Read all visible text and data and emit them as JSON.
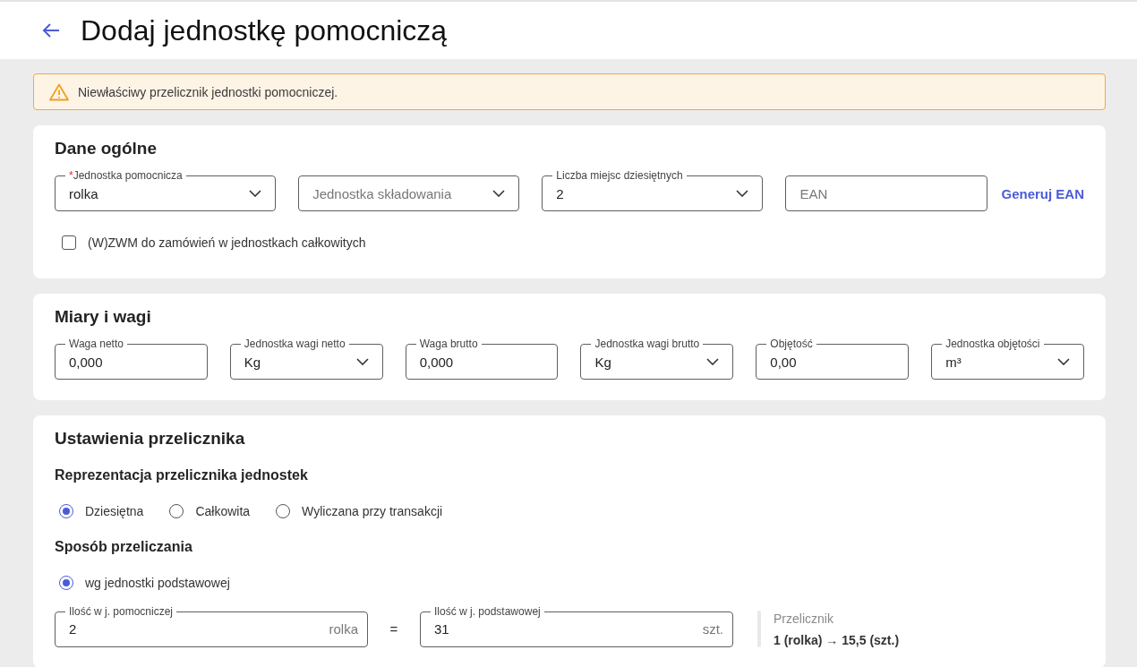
{
  "header": {
    "title": "Dodaj jednostkę pomocniczą"
  },
  "alert": {
    "kind": "warning",
    "message": "Niewłaściwy przelicznik jednostki pomocniczej."
  },
  "general": {
    "title": "Dane ogólne",
    "fields": [
      {
        "kind": "select",
        "required_mark": "*",
        "label": "Jednostka pomocnicza",
        "value": "rolka"
      },
      {
        "kind": "select",
        "placeholder": "Jednostka składowania"
      },
      {
        "kind": "select",
        "label": "Liczba miejsc dziesiętnych",
        "value": "2"
      },
      {
        "kind": "text",
        "placeholder": "EAN"
      }
    ],
    "generate_link": "Generuj EAN",
    "checkbox": {
      "label": "(W)ZWM do zamówień w jednostkach całkowitych",
      "checked": false
    }
  },
  "measures": {
    "title": "Miary i wagi",
    "fields": [
      {
        "kind": "text",
        "label": "Waga netto",
        "value": "0,000"
      },
      {
        "kind": "select",
        "label": "Jednostka wagi netto",
        "value": "Kg"
      },
      {
        "kind": "text",
        "label": "Waga brutto",
        "value": "0,000"
      },
      {
        "kind": "select",
        "label": "Jednostka wagi brutto",
        "value": "Kg"
      },
      {
        "kind": "text",
        "label": "Objętość",
        "value": "0,00"
      },
      {
        "kind": "select",
        "label": "Jednostka objętości",
        "value": "m³"
      }
    ]
  },
  "converter": {
    "title": "Ustawienia przelicznika",
    "representation": {
      "title": "Reprezentacja przelicznika jednostek",
      "options": [
        {
          "label": "Dziesiętna",
          "selected": true
        },
        {
          "label": "Całkowita",
          "selected": false
        },
        {
          "label": "Wyliczana przy transakcji",
          "selected": false
        }
      ]
    },
    "method": {
      "title": "Sposób przeliczania",
      "options": [
        {
          "label": "wg jednostki podstawowej",
          "selected": true
        }
      ]
    },
    "quantities": [
      {
        "label": "Ilość w j. pomocniczej",
        "value": "2",
        "unit": "rolka"
      },
      {
        "label": "Ilość w j. podstawowej",
        "value": "31",
        "unit": "szt."
      }
    ],
    "equals": "=",
    "summary": {
      "label": "Przelicznik",
      "value": "1 (rolka) → 15,5 (szt.)"
    }
  }
}
